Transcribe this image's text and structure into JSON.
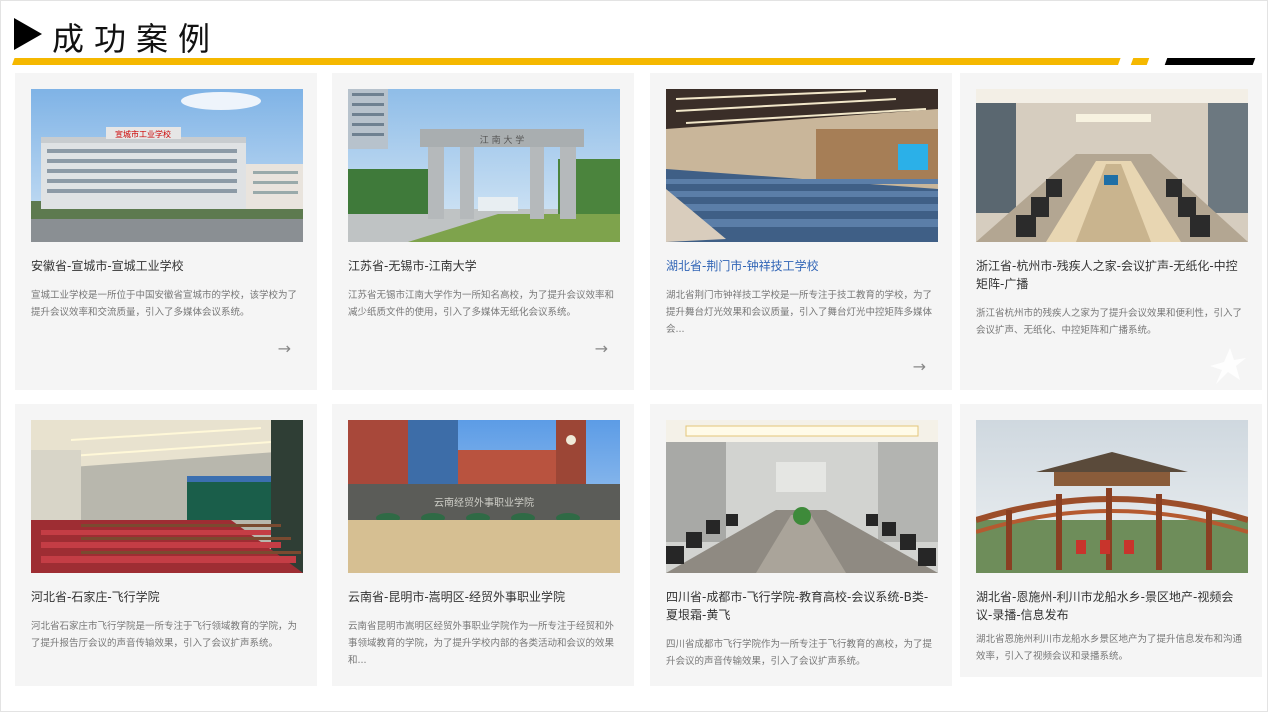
{
  "header": {
    "title": "成功案例"
  },
  "cases": [
    {
      "title": "安徽省-宣城市-宣城工业学校",
      "desc": "宣城工业学校是一所位于中国安徽省宣城市的学校，该学校为了提升会议效率和交流质量，引入了多媒体会议系统。",
      "photo_label": "宣城市工业学校",
      "arrow": "→"
    },
    {
      "title": "江苏省-无锡市-江南大学",
      "desc": "江苏省无锡市江南大学作为一所知名高校，为了提升会议效率和减少纸质文件的使用，引入了多媒体无纸化会议系统。",
      "photo_label": "江 南 大 学",
      "arrow": "→"
    },
    {
      "title": "湖北省-荆门市-钟祥技工学校",
      "desc": "湖北省荆门市钟祥技工学校是一所专注于技工教育的学校，为了提升舞台灯光效果和会议质量，引入了舞台灯光中控矩阵多媒体会...",
      "arrow": "→"
    },
    {
      "title": "浙江省-杭州市-残疾人之家-会议扩声-无纸化-中控矩阵-广播",
      "desc": "浙江省杭州市的残疾人之家为了提升会议效果和便利性，引入了会议扩声、无纸化、中控矩阵和广播系统。"
    },
    {
      "title": "河北省-石家庄-飞行学院",
      "desc": "河北省石家庄市飞行学院是一所专注于飞行领域教育的学院，为了提升报告厅会议的声音传输效果，引入了会议扩声系统。"
    },
    {
      "title": "云南省-昆明市-嵩明区-经贸外事职业学院",
      "desc": "云南省昆明市嵩明区经贸外事职业学院作为一所专注于经贸和外事领域教育的学院，为了提升学校内部的各类活动和会议的效果和...",
      "photo_label": "云南经贸外事职业学院"
    },
    {
      "title": "四川省-成都市-飞行学院-教育高校-会议系统-B类-夏垠霜-黄飞",
      "desc": "四川省成都市飞行学院作为一所专注于飞行教育的高校，为了提升会议的声音传输效果，引入了会议扩声系统。"
    },
    {
      "title": "湖北省-恩施州-利川市龙船水乡-景区地产-视频会议-录播-信息发布",
      "desc": "湖北省恩施州利川市龙船水乡景区地产为了提升信息发布和沟通效率，引入了视频会议和录播系统。"
    }
  ],
  "colors": {
    "accent_yellow": "#f5b800",
    "link_blue": "#3165b6",
    "card_bg": "#f5f5f5"
  }
}
